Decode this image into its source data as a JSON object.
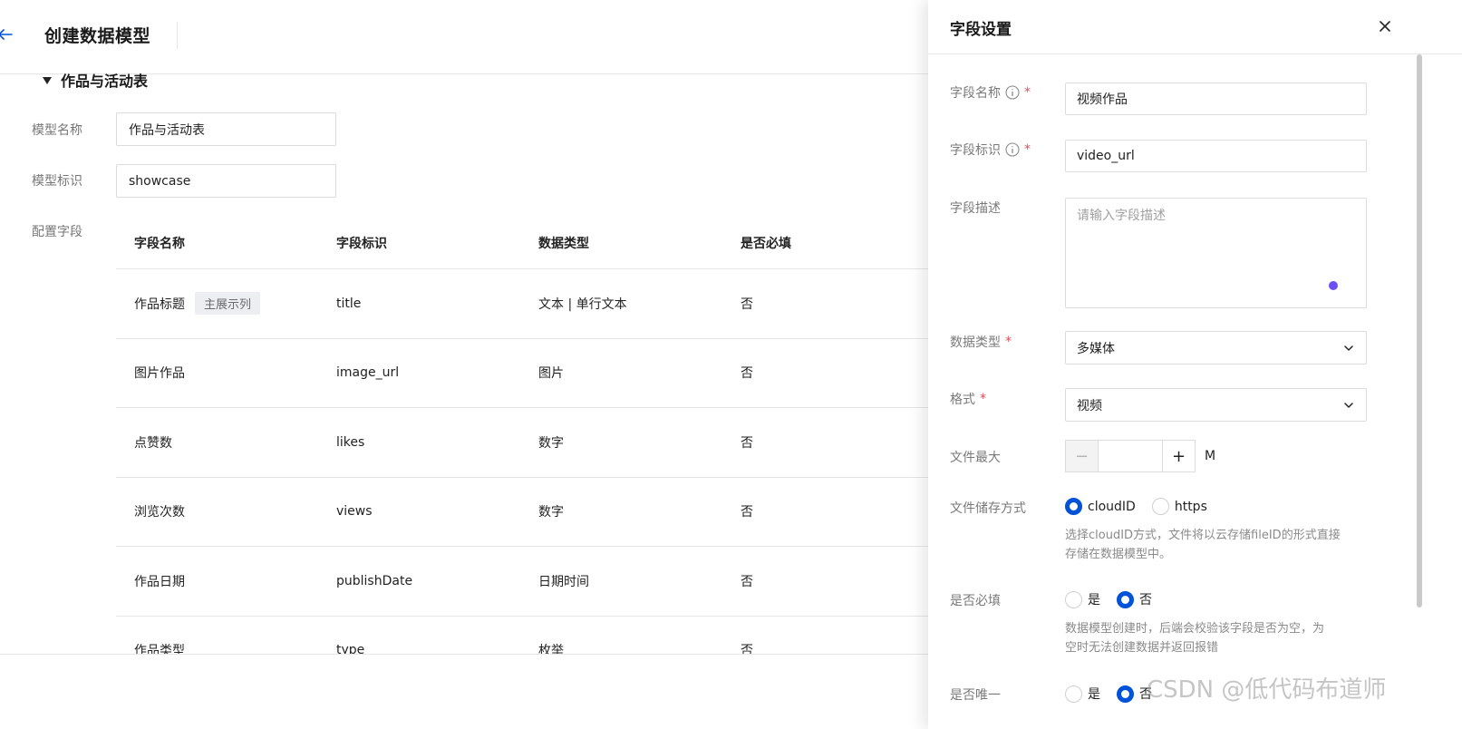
{
  "header": {
    "title": "创建数据模型"
  },
  "section": {
    "title": "作品与活动表"
  },
  "form": {
    "model_name_label": "模型名称",
    "model_name_value": "作品与活动表",
    "model_id_label": "模型标识",
    "model_id_value": "showcase",
    "fields_label": "配置字段"
  },
  "table": {
    "headers": [
      "字段名称",
      "字段标识",
      "数据类型",
      "是否必填"
    ],
    "rows": [
      {
        "name": "作品标题",
        "tag": "主展示列",
        "id": "title",
        "type": "文本 | 单行文本",
        "required": "否"
      },
      {
        "name": "图片作品",
        "id": "image_url",
        "type": "图片",
        "required": "否"
      },
      {
        "name": "点赞数",
        "id": "likes",
        "type": "数字",
        "required": "否"
      },
      {
        "name": "浏览次数",
        "id": "views",
        "type": "数字",
        "required": "否"
      },
      {
        "name": "作品日期",
        "id": "publishDate",
        "type": "日期时间",
        "required": "否"
      },
      {
        "name": "作品类型",
        "id": "type",
        "type": "枚举",
        "required": "否"
      }
    ]
  },
  "drawer": {
    "title": "字段设置",
    "field_name_label": "字段名称",
    "field_name_value": "视频作品",
    "field_id_label": "字段标识",
    "field_id_value": "video_url",
    "field_desc_label": "字段描述",
    "field_desc_placeholder": "请输入字段描述",
    "data_type_label": "数据类型",
    "data_type_value": "多媒体",
    "format_label": "格式",
    "format_value": "视频",
    "max_size_label": "文件最大",
    "max_size_unit": "M",
    "storage_label": "文件储存方式",
    "storage_options": [
      "cloudID",
      "https"
    ],
    "storage_selected": "cloudID",
    "storage_help_line1": "选择cloudID方式，文件将以云存储fileID的形式直接",
    "storage_help_line2": "存储在数据模型中。",
    "required_label": "是否必填",
    "required_options": [
      "是",
      "否"
    ],
    "required_selected": "否",
    "required_help_line1": "数据模型创建时，后端会校验该字段是否为空，为",
    "required_help_line2": "空时无法创建数据并返回报错",
    "unique_label": "是否唯一",
    "unique_options": [
      "是",
      "否"
    ],
    "unique_selected": "否",
    "required_mark": "*"
  },
  "watermark": "CSDN @低代码布道师",
  "colors": {
    "primary": "#0052d9",
    "required": "#e34d59",
    "scroll_dot": "#6b4ef5"
  }
}
